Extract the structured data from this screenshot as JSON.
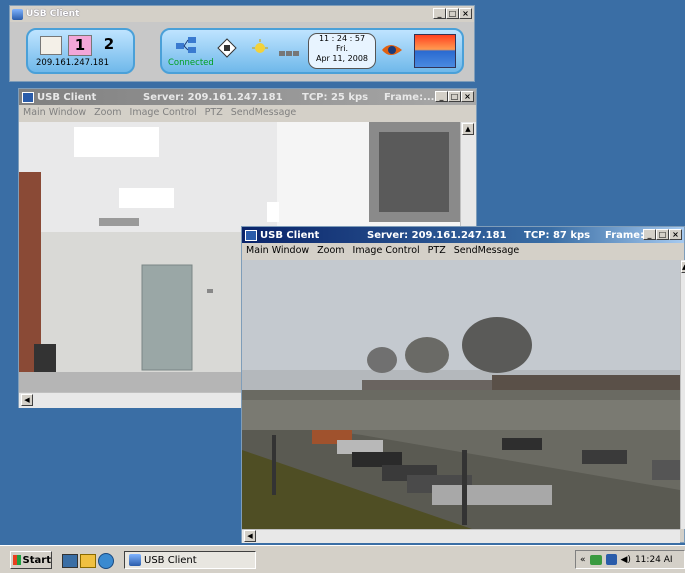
{
  "toolbar_window": {
    "title": "USB Client",
    "camera_1": "1",
    "camera_2": "2",
    "ip": "209.161.247.181",
    "status": "Connected",
    "clock_time": "11 : 24 : 57",
    "clock_day": "Fri.",
    "clock_date": "Apr 11, 2008"
  },
  "viewer_back": {
    "title": "USB Client",
    "server": "Server:  209.161.247.181",
    "tcp": "TCP: 25 kps",
    "frame": "Frame:...",
    "menu": [
      "Main Window",
      "Zoom",
      "Image Control",
      "PTZ",
      "SendMessage"
    ]
  },
  "viewer_front": {
    "title": "USB Client",
    "server": "Server:  209.161.247.181",
    "tcp": "TCP: 87 kps",
    "frame": "Frame:...",
    "menu": [
      "Main Window",
      "Zoom",
      "Image Control",
      "PTZ",
      "SendMessage"
    ]
  },
  "taskbar": {
    "start": "Start",
    "task_item": "USB Client",
    "tray_chevron": "«",
    "tray_time": "11:24 AI"
  },
  "colors": {
    "desktop": "#3a6ea5",
    "titlebar_active": "#0a246a",
    "panel_blue": "#6fb8ea"
  },
  "icons": [
    "network-icon",
    "video-icon",
    "light-icon",
    "signal-icon",
    "window-icon"
  ]
}
